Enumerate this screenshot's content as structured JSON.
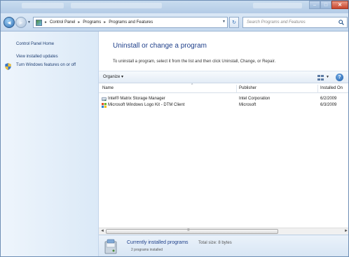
{
  "window": {
    "controls": {
      "minimize": "–",
      "maximize": "□",
      "close": "✕"
    }
  },
  "nav": {
    "back": "◄",
    "forward": "►",
    "menu_arrow": "▼",
    "breadcrumbs": [
      "Control Panel",
      "Programs",
      "Programs and Features"
    ],
    "separator": "►",
    "dropdown": "▼",
    "refresh": "↻",
    "search_placeholder": "Search Programs and Features"
  },
  "sidebar": {
    "items": [
      {
        "label": "Control Panel Home"
      },
      {
        "label": "View installed updates"
      },
      {
        "label": "Turn Windows features on or off",
        "icon": "shield-icon"
      }
    ]
  },
  "main": {
    "title": "Uninstall or change a program",
    "description": "To uninstall a program, select it from the list and then click Uninstall, Change, or Repair.",
    "toolbar": {
      "organize": "Organize ▾",
      "views_arrow": "▼",
      "help": "?"
    },
    "columns": [
      "Name",
      "Publisher",
      "Installed On"
    ],
    "sort_indicator": "^",
    "programs": [
      {
        "name": "Intel® Matrix Storage Manager",
        "publisher": "Intel Corporation",
        "installed_on": "6/2/2009",
        "icon": "intel-program-icon"
      },
      {
        "name": "Microsoft Windows Logo Kit - DTM Client",
        "publisher": "Microsoft",
        "installed_on": "6/3/2009",
        "icon": "windows-program-icon"
      }
    ]
  },
  "scrollbar": {
    "left": "◄",
    "right": "►",
    "grip": "≡"
  },
  "details": {
    "title": "Currently installed programs",
    "total_size": "Total size: 8 bytes",
    "count": "2 programs installed"
  },
  "colors": {
    "title_blue": "#1e3f8a",
    "link_blue": "#1f3f73",
    "accent": "#2f6fb3"
  }
}
